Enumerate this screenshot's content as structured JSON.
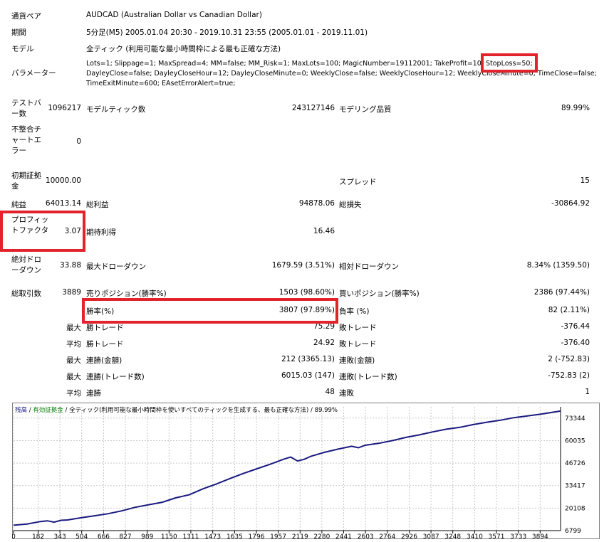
{
  "header": {
    "pair_label": "通貨ペア",
    "pair_value": "AUDCAD (Australian Dollar vs Canadian Dollar)",
    "period_label": "期間",
    "period_value": "5分足(M5) 2005.01.04 20:30 - 2019.10.31 23:55 (2005.01.01 - 2019.11.01)",
    "model_label": "モデル",
    "model_value": "全ティック (利用可能な最小時間枠による最も正確な方法)",
    "params_label": "パラメーター",
    "params_line1a": "Lots=1; Slippage=1; MaxSpread=4; MM=false; MM_Risk=1; MaxLots=100; MagicNumber=19112001; TakeProfit=10;",
    "params_line1b": "StopLoss=50;",
    "params_line2": "DayleyClose=false; DayleyCloseHour=12; DayleyCloseMinute=0; WeeklyClose=false; WeeklyCloseHour=12; WeeklyCloseMinute=0; TimeClose=false;",
    "params_line3": "TimeExitMinute=600; EAsetErrorAlert=true;"
  },
  "stats": {
    "bars_label": "テストバー数",
    "bars_value": "1096217",
    "ticks_label": "モデルティック数",
    "ticks_value": "243127146",
    "quality_label": "モデリング品質",
    "quality_value": "89.99%",
    "mismatch_label": "不整合チャートエラー",
    "mismatch_value": "0",
    "deposit_label": "初期証拠金",
    "deposit_value": "10000.00",
    "spread_label": "スプレッド",
    "spread_value": "15",
    "net_label": "純益",
    "net_value": "64013.14",
    "gross_profit_label": "総利益",
    "gross_profit_value": "94878.06",
    "gross_loss_label": "総損失",
    "gross_loss_value": "-30864.92",
    "pf_label": "プロフィットファクタ",
    "pf_value": "3.07",
    "expected_label": "期待利得",
    "expected_value": "16.46",
    "abs_dd_label": "絶対ドローダウン",
    "abs_dd_value": "33.88",
    "max_dd_label": "最大ドローダウン",
    "max_dd_value": "1679.59 (3.51%)",
    "rel_dd_label": "相対ドローダウン",
    "rel_dd_value": "8.34% (1359.50)"
  },
  "trades": {
    "total_label": "総取引数",
    "total_value": "3889",
    "short_label": "売りポジション(勝率%)",
    "short_value": "1503 (98.60%)",
    "long_label": "買いポジション(勝率%)",
    "long_value": "2386 (97.44%)",
    "winrate_label": "勝率(%)",
    "winrate_value": "3807 (97.89%)",
    "lossrate_label": "負率 (%)",
    "lossrate_value": "82 (2.11%)",
    "rows": [
      {
        "prefix": "最大",
        "l_label": "勝トレード",
        "l_value": "75.29",
        "r_label": "敗トレード",
        "r_value": "-376.44"
      },
      {
        "prefix": "平均",
        "l_label": "勝トレード",
        "l_value": "24.92",
        "r_label": "敗トレード",
        "r_value": "-376.40"
      },
      {
        "prefix": "最大",
        "l_label": "連勝(金額)",
        "l_value": "212 (3365.13)",
        "r_label": "連敗(金額)",
        "r_value": "2 (-752.83)"
      },
      {
        "prefix": "最大",
        "l_label": "連勝(トレード数)",
        "l_value": "6015.03 (147)",
        "r_label": "連敗(トレード数)",
        "r_value": "-752.83 (2)"
      },
      {
        "prefix": "平均",
        "l_label": "連勝",
        "l_value": "48",
        "r_label": "連敗",
        "r_value": "1"
      }
    ]
  },
  "chart_legend": {
    "balance": "残高",
    "sep1": " / ",
    "equity": "有効証拠金",
    "sep2": " / ",
    "model": "全ティック(利用可能な最小時間枠を使いすべてのティックを生成する、最も正確な方法)",
    "sep3": " / ",
    "quality": "89.99%"
  },
  "colors": {
    "highlight_box": "#e3232c",
    "balance_line": "#1a1a80",
    "equity_legend": "#008000",
    "grid": "#c8c8c8"
  },
  "chart_data": {
    "type": "line",
    "title": "",
    "xlabel": "",
    "ylabel": "",
    "xlim": [
      0,
      4045
    ],
    "ylim": [
      6799,
      79995
    ],
    "x_ticks": [
      0,
      182,
      343,
      504,
      666,
      827,
      989,
      1150,
      1311,
      1473,
      1635,
      1796,
      1957,
      2119,
      2280,
      2441,
      2603,
      2764,
      2926,
      3087,
      3248,
      3410,
      3571,
      3733,
      3894
    ],
    "y_ticks": [
      6799,
      20108,
      33417,
      46726,
      60035,
      73344
    ],
    "grid": true,
    "series": [
      {
        "name": "残高",
        "x": [
          0,
          100,
          200,
          250,
          300,
          350,
          400,
          500,
          600,
          700,
          800,
          900,
          1000,
          1100,
          1200,
          1300,
          1400,
          1500,
          1600,
          1700,
          1800,
          1900,
          2000,
          2050,
          2100,
          2150,
          2200,
          2300,
          2400,
          2500,
          2550,
          2600,
          2700,
          2800,
          2900,
          3000,
          3100,
          3200,
          3300,
          3400,
          3500,
          3600,
          3700,
          3800,
          3894,
          4045
        ],
        "y": [
          10000,
          10700,
          12200,
          12600,
          11800,
          12900,
          13100,
          14400,
          15600,
          16800,
          18500,
          20600,
          22100,
          23600,
          26200,
          28000,
          31500,
          34400,
          37600,
          40600,
          43400,
          46100,
          49100,
          50300,
          48000,
          49000,
          50800,
          53100,
          55000,
          56700,
          55800,
          57300,
          58400,
          60000,
          61900,
          63400,
          65200,
          66800,
          67900,
          69500,
          70900,
          72100,
          73600,
          74600,
          75600,
          77500
        ]
      }
    ]
  }
}
